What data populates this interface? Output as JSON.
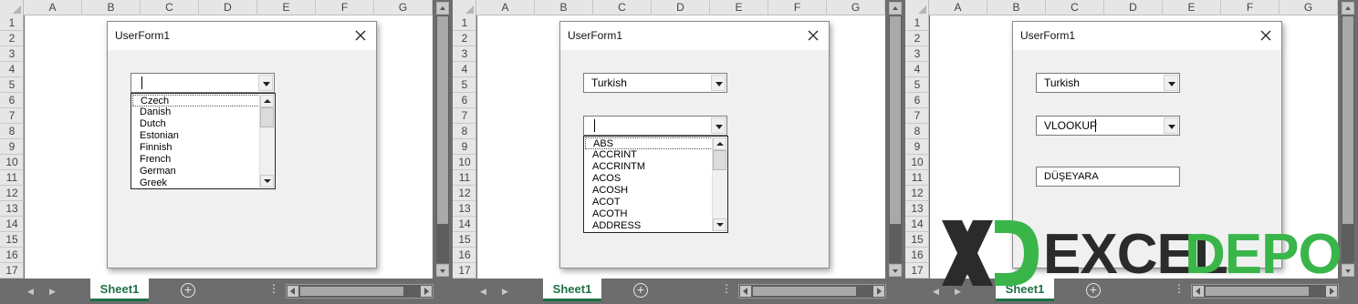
{
  "columns": [
    "A",
    "B",
    "C",
    "D",
    "E",
    "F",
    "G"
  ],
  "rows": [
    "1",
    "2",
    "3",
    "4",
    "5",
    "6",
    "7",
    "8",
    "9",
    "10",
    "11",
    "12",
    "13",
    "14",
    "15",
    "16",
    "17"
  ],
  "sheet_tab": "Sheet1",
  "add_sheet_glyph": "⊕",
  "more_glyph": "⋮",
  "nav_prev_glyph": "◀",
  "nav_next_glyph": "▶",
  "userform_title": "UserForm1",
  "panels": [
    {
      "language_value": "",
      "language_options": [
        "Czech",
        "Danish",
        "Dutch",
        "Estonian",
        "Finnish",
        "French",
        "German",
        "Greek"
      ],
      "function_value": null,
      "function_options": null,
      "result_value": null
    },
    {
      "language_value": "Turkish",
      "language_options": null,
      "function_value": "",
      "function_options": [
        "ABS",
        "ACCRINT",
        "ACCRINTM",
        "ACOS",
        "ACOSH",
        "ACOT",
        "ACOTH",
        "ADDRESS"
      ],
      "result_value": null
    },
    {
      "language_value": "Turkish",
      "language_options": null,
      "function_value": "VLOOKUP",
      "function_options": null,
      "result_value": "DÜŞEYARA"
    }
  ],
  "logo": {
    "part1": "EXCEL",
    "part2": "DEPO",
    "dark_color": "#2b2b2b",
    "green_color": "#3ab54a"
  },
  "colors": {
    "excel_green": "#1e7145",
    "frame_gray": "#6d6d6d",
    "header_gray": "#e6e6e6"
  }
}
